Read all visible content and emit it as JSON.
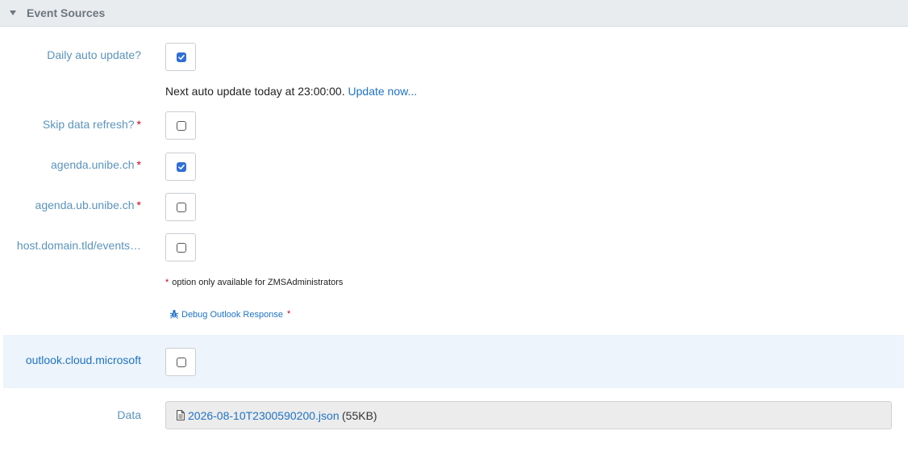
{
  "section": {
    "title": "Event Sources"
  },
  "daily_update": {
    "label": "Daily auto update?",
    "checked": true,
    "next_text": "Next auto update today at 23:00:00.",
    "update_link": "Update now..."
  },
  "sources": [
    {
      "label": "Skip data refresh?",
      "required": "*",
      "checked": false
    },
    {
      "label": "agenda.unibe.ch",
      "required": "*",
      "checked": true
    },
    {
      "label": "agenda.ub.unibe.ch",
      "required": "*",
      "checked": false
    },
    {
      "label": "host.domain.tld/events…",
      "required": "",
      "checked": false
    }
  ],
  "note": {
    "marker": "*",
    "text": "option only available for ZMSAdministrators"
  },
  "debug": {
    "label": "Debug Outlook Response",
    "required": "*"
  },
  "outlook": {
    "label": "outlook.cloud.microsoft",
    "checked": false
  },
  "data": {
    "label": "Data",
    "file_name": "2026-08-10T2300590200.json",
    "file_size": "(55KB)"
  },
  "colors": {
    "label": "#5b94bd",
    "link": "#1f73c4",
    "required": "#d0021b",
    "checked": "#2f6fd6",
    "highlight_row": "#edf4fb"
  }
}
